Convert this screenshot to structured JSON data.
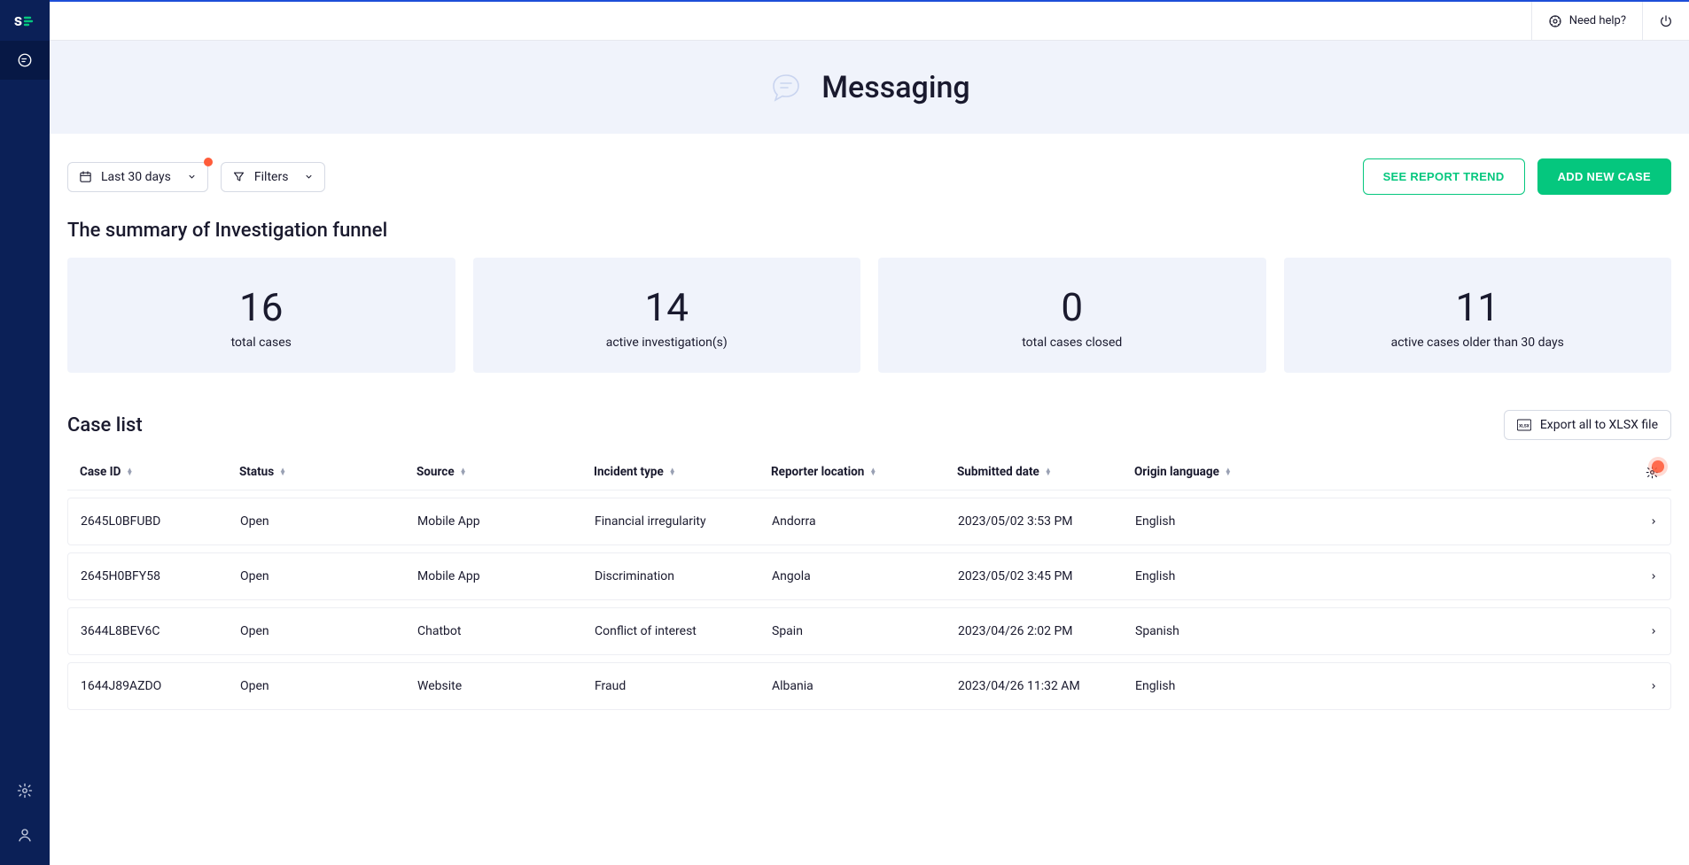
{
  "topbar": {
    "help_label": "Need help?"
  },
  "hero": {
    "title": "Messaging"
  },
  "filters": {
    "date_label": "Last 30 days",
    "filters_label": "Filters",
    "see_trend_label": "SEE REPORT TREND",
    "add_case_label": "ADD NEW CASE"
  },
  "summary": {
    "title": "The summary of Investigation funnel",
    "cards": [
      {
        "value": "16",
        "label": "total cases"
      },
      {
        "value": "14",
        "label": "active investigation(s)"
      },
      {
        "value": "0",
        "label": "total cases closed"
      },
      {
        "value": "11",
        "label": "active cases older than 30 days"
      }
    ]
  },
  "caselist": {
    "title": "Case list",
    "export_label": "Export all to XLSX file",
    "columns": [
      "Case ID",
      "Status",
      "Source",
      "Incident type",
      "Reporter location",
      "Submitted date",
      "Origin language"
    ],
    "rows": [
      {
        "case_id": "2645L0BFUBD",
        "status": "Open",
        "source": "Mobile App",
        "incident_type": "Financial irregularity",
        "reporter_location": "Andorra",
        "submitted_date": "2023/05/02 3:53 PM",
        "origin_language": "English"
      },
      {
        "case_id": "2645H0BFY58",
        "status": "Open",
        "source": "Mobile App",
        "incident_type": "Discrimination",
        "reporter_location": "Angola",
        "submitted_date": "2023/05/02 3:45 PM",
        "origin_language": "English"
      },
      {
        "case_id": "3644L8BEV6C",
        "status": "Open",
        "source": "Chatbot",
        "incident_type": "Conflict of interest",
        "reporter_location": "Spain",
        "submitted_date": "2023/04/26 2:02 PM",
        "origin_language": "Spanish"
      },
      {
        "case_id": "1644J89AZDO",
        "status": "Open",
        "source": "Website",
        "incident_type": "Fraud",
        "reporter_location": "Albania",
        "submitted_date": "2023/04/26 11:32 AM",
        "origin_language": "English"
      }
    ]
  },
  "colors": {
    "sidebar_bg": "#0b2057",
    "accent": "#05c77e",
    "hero_bg": "#f0f3fb",
    "alert": "#ff5c3a"
  }
}
